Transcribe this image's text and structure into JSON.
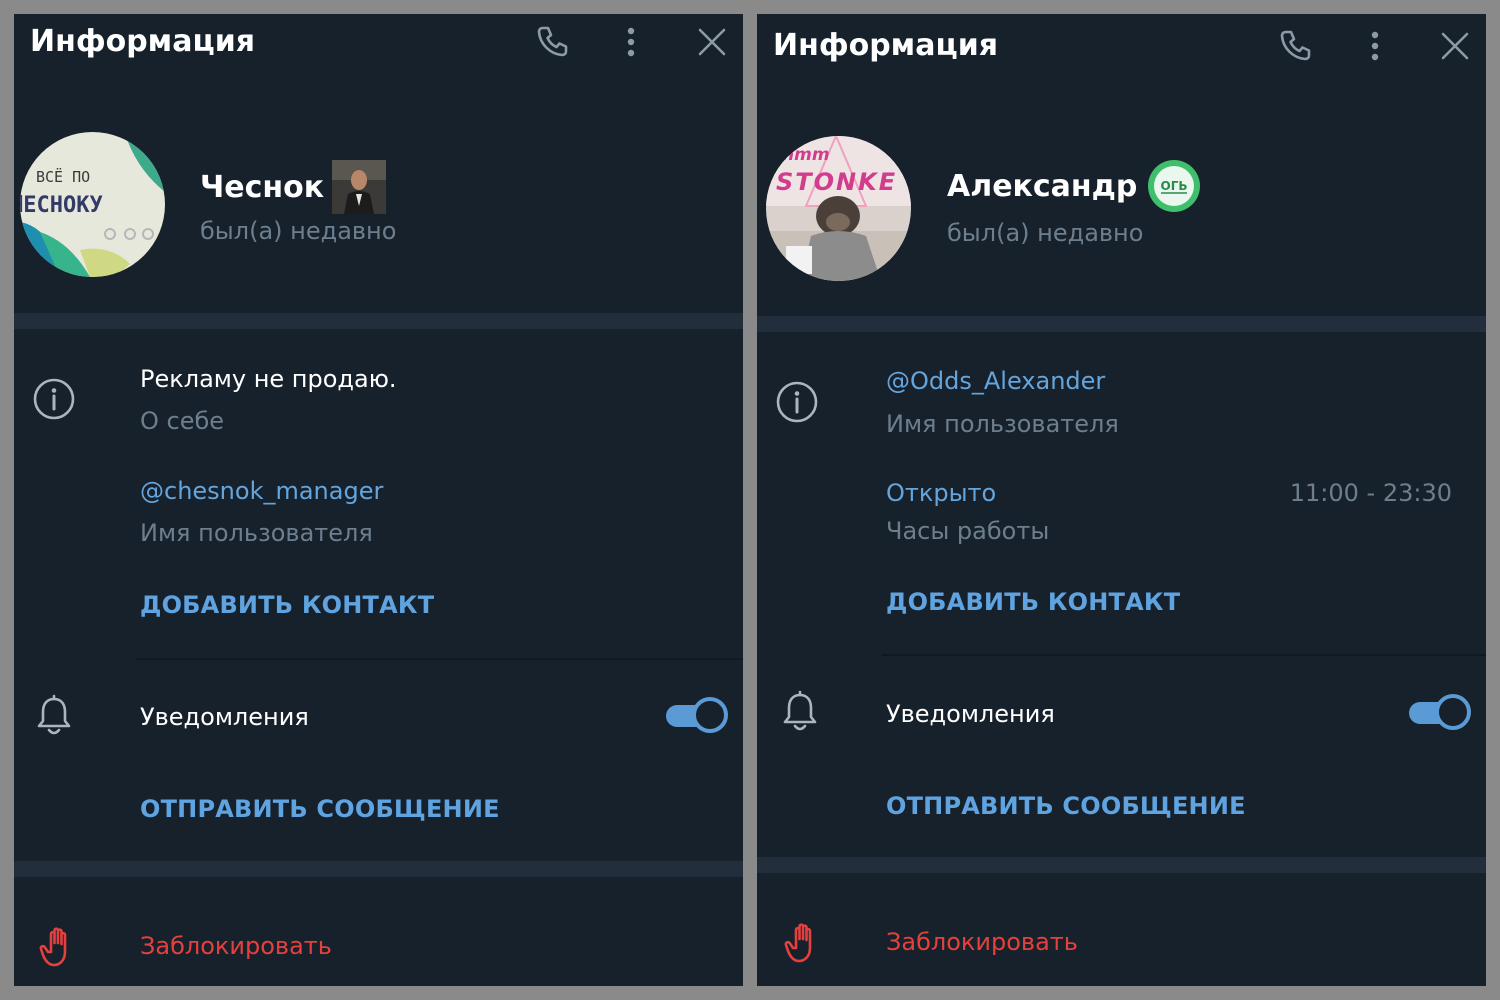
{
  "left": {
    "header_title": "Информация",
    "name": "Чеснок",
    "status": "был(а) недавно",
    "avatar_text": [
      "ВСЁ ПО",
      "ЧЕСНОКУ"
    ],
    "about": {
      "value": "Рекламу не продаю.",
      "label": "О себе"
    },
    "username": {
      "value": "@chesnok_manager",
      "label": "Имя пользователя"
    },
    "add_contact": "ДОБАВИТЬ КОНТАКТ",
    "notifications": {
      "label": "Уведомления",
      "enabled": true
    },
    "send_message": "ОТПРАВИТЬ СООБЩЕНИЕ",
    "block": "Заблокировать"
  },
  "right": {
    "header_title": "Информация",
    "name": "Александр",
    "status": "был(а) недавно",
    "avatar_text": [
      "hmm",
      "STONKE"
    ],
    "emoji_status_text": "ОГЬ",
    "username": {
      "value": "@Odds_Alexander",
      "label": "Имя пользователя"
    },
    "hours": {
      "value": "Открыто",
      "label": "Часы работы",
      "range": "11:00 - 23:30"
    },
    "add_contact": "ДОБАВИТЬ КОНТАКТ",
    "notifications": {
      "label": "Уведомления",
      "enabled": true
    },
    "send_message": "ОТПРАВИТЬ СООБЩЕНИЕ",
    "block": "Заблокировать"
  },
  "icons": [
    "phone-icon",
    "more-vertical-icon",
    "close-icon",
    "info-icon",
    "bell-icon",
    "hand-stop-icon"
  ],
  "colors": {
    "panel_bg": "#17212b",
    "separator": "#232e3c",
    "accent": "#5fa3e0",
    "link": "#64a5dd",
    "secondary_text": "#6d7f8f",
    "danger": "#e5403d",
    "outer_bg": "#8a8a8a"
  }
}
